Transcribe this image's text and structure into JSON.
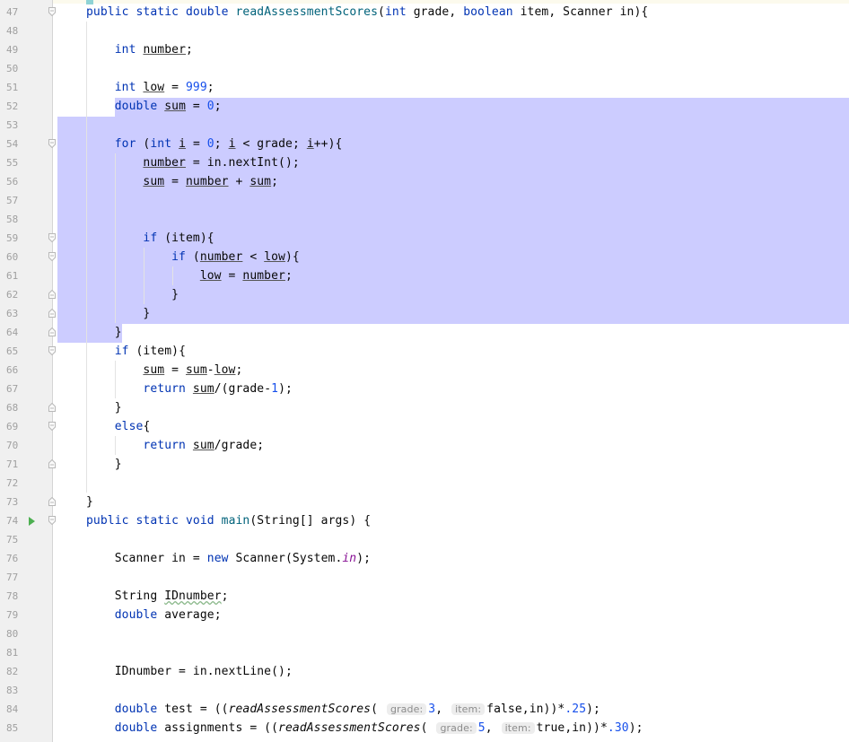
{
  "editor": {
    "language": "Java",
    "run_icon_line": 74,
    "selection": {
      "from_line": 52,
      "to_line": 64
    },
    "lines": [
      {
        "n": 47,
        "text": "public static double readAssessmentScores(int grade, boolean item, Scanner in){"
      },
      {
        "n": 48,
        "text": ""
      },
      {
        "n": 49,
        "text": "    int number;"
      },
      {
        "n": 50,
        "text": ""
      },
      {
        "n": 51,
        "text": "    int low = 999;"
      },
      {
        "n": 52,
        "text": "    double sum = 0;"
      },
      {
        "n": 53,
        "text": ""
      },
      {
        "n": 54,
        "text": "    for (int i = 0; i < grade; i++){"
      },
      {
        "n": 55,
        "text": "        number = in.nextInt();"
      },
      {
        "n": 56,
        "text": "        sum = number + sum;"
      },
      {
        "n": 57,
        "text": ""
      },
      {
        "n": 58,
        "text": ""
      },
      {
        "n": 59,
        "text": "        if (item){"
      },
      {
        "n": 60,
        "text": "            if (number < low){"
      },
      {
        "n": 61,
        "text": "                low = number;"
      },
      {
        "n": 62,
        "text": "            }"
      },
      {
        "n": 63,
        "text": "        }"
      },
      {
        "n": 64,
        "text": "    }"
      },
      {
        "n": 65,
        "text": "    if (item){"
      },
      {
        "n": 66,
        "text": "        sum = sum-low;"
      },
      {
        "n": 67,
        "text": "        return sum/(grade-1);"
      },
      {
        "n": 68,
        "text": "    }"
      },
      {
        "n": 69,
        "text": "    else{"
      },
      {
        "n": 70,
        "text": "        return sum/grade;"
      },
      {
        "n": 71,
        "text": "    }"
      },
      {
        "n": 72,
        "text": ""
      },
      {
        "n": 73,
        "text": "}"
      },
      {
        "n": 74,
        "text": "public static void main(String[] args) {"
      },
      {
        "n": 75,
        "text": ""
      },
      {
        "n": 76,
        "text": "    Scanner in = new Scanner(System.in);"
      },
      {
        "n": 77,
        "text": ""
      },
      {
        "n": 78,
        "text": "    String IDnumber;"
      },
      {
        "n": 79,
        "text": "    double average;"
      },
      {
        "n": 80,
        "text": ""
      },
      {
        "n": 81,
        "text": ""
      },
      {
        "n": 82,
        "text": "    IDnumber = in.nextLine();"
      },
      {
        "n": 83,
        "text": ""
      },
      {
        "n": 84,
        "text": "    double test = ((readAssessmentScores( grade: 3, item: false,in))*.25);"
      },
      {
        "n": 85,
        "text": "    double assignments = ((readAssessmentScores( grade: 5, item: true,in))*.30);"
      }
    ],
    "hints": {
      "grade": "grade:",
      "item": "item:"
    }
  }
}
